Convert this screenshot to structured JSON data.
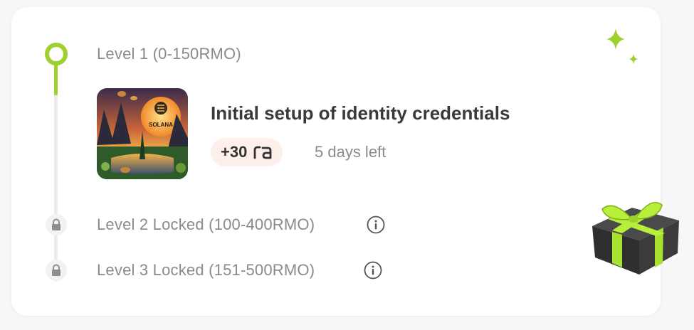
{
  "levels": [
    {
      "label": "Level 1 (0-150RMO)",
      "state": "active"
    },
    {
      "label": "Level 2 Locked (100-400RMO)",
      "state": "locked"
    },
    {
      "label": "Level 3 Locked (151-500RMO)",
      "state": "locked"
    }
  ],
  "task": {
    "thumbnail_text": "SOLANA",
    "title": "Initial setup of identity credentials",
    "reward_amount": "+30",
    "reward_currency_icon": "ra-token-icon",
    "days_left": "5 days left"
  },
  "colors": {
    "accent": "#9ed12d",
    "reward_bg": "#fdf0ea",
    "muted_text": "#8a8a8a"
  },
  "icons": [
    "lock-icon",
    "info-icon",
    "sparkle-icon",
    "gift-icon"
  ]
}
